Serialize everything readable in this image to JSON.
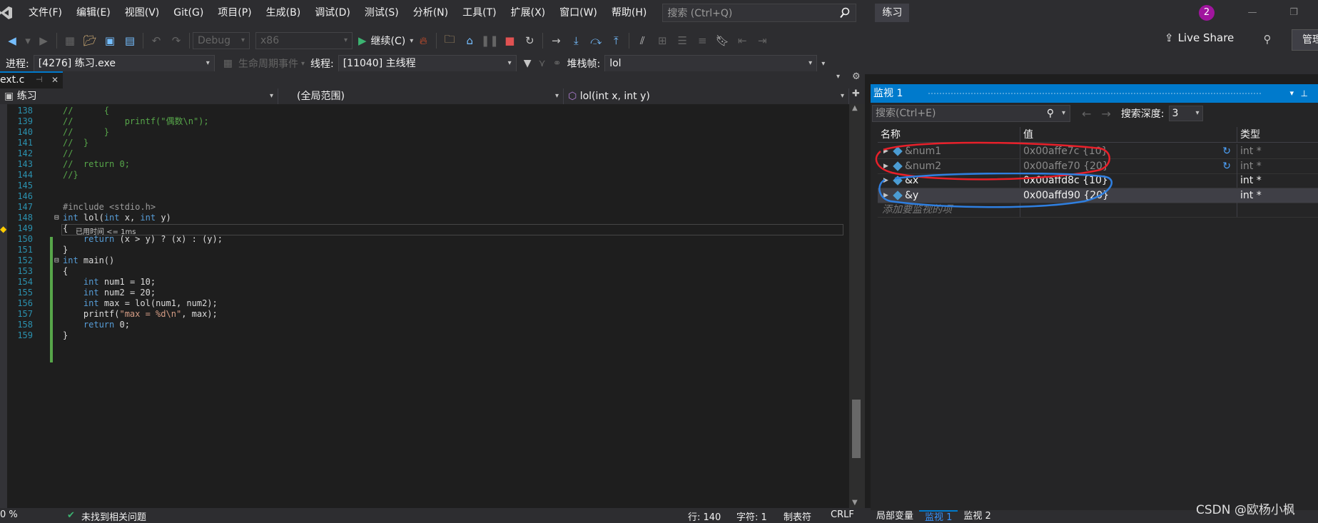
{
  "menu": {
    "items": [
      "文件(F)",
      "编辑(E)",
      "视图(V)",
      "Git(G)",
      "项目(P)",
      "生成(B)",
      "调试(D)",
      "测试(S)",
      "分析(N)",
      "工具(T)",
      "扩展(X)",
      "窗口(W)",
      "帮助(H)"
    ],
    "search_placeholder": "搜索 (Ctrl+Q)",
    "solution_name": "练习",
    "notification_count": "2"
  },
  "toolbar": {
    "configuration": "Debug",
    "platform": "x86",
    "continue_label": "继续(C)",
    "live_share_label": "Live Share",
    "manage_label": "管理"
  },
  "debug_location": {
    "process_label": "进程:",
    "process_value": "[4276] 练习.exe",
    "lifecycle_label": "生命周期事件",
    "thread_label": "线程:",
    "thread_value": "[11040] 主线程",
    "stackframe_label": "堆栈帧:",
    "stackframe_value": "lol"
  },
  "editor": {
    "tab_title": "ext.c",
    "nav_project": "练习",
    "nav_scope": "(全局范围)",
    "nav_member": "lol(int x, int y)",
    "perf_tip": "已用时间 <= 1ms",
    "lines": [
      {
        "n": "138",
        "text": "//      {"
      },
      {
        "n": "139",
        "text": "//          printf(\"偶数\\n\");"
      },
      {
        "n": "140",
        "text": "//      }"
      },
      {
        "n": "141",
        "text": "//  }"
      },
      {
        "n": "142",
        "text": "//"
      },
      {
        "n": "143",
        "text": "//  return 0;"
      },
      {
        "n": "144",
        "text": "//}"
      },
      {
        "n": "145",
        "text": ""
      },
      {
        "n": "146",
        "text": ""
      },
      {
        "n": "147",
        "text": "#include <stdio.h>"
      },
      {
        "n": "148",
        "text": "int lol(int x, int y)"
      },
      {
        "n": "149",
        "text": "{"
      },
      {
        "n": "150",
        "text": "    return (x > y) ? (x) : (y);"
      },
      {
        "n": "151",
        "text": "}"
      },
      {
        "n": "152",
        "text": "int main()"
      },
      {
        "n": "153",
        "text": "{"
      },
      {
        "n": "154",
        "text": "    int num1 = 10;"
      },
      {
        "n": "155",
        "text": "    int num2 = 20;"
      },
      {
        "n": "156",
        "text": "    int max = lol(num1, num2);"
      },
      {
        "n": "157",
        "text": "    printf(\"max = %d\\n\", max);"
      },
      {
        "n": "158",
        "text": "    return 0;"
      },
      {
        "n": "159",
        "text": "}"
      }
    ]
  },
  "watch": {
    "title": "监视 1",
    "search_placeholder": "搜索(Ctrl+E)",
    "depth_label": "搜索深度:",
    "depth_value": "3",
    "columns": [
      "名称",
      "值",
      "类型"
    ],
    "rows": [
      {
        "name": "&num1",
        "value": "0x00affe7c {10}",
        "type": "int *",
        "stale": true
      },
      {
        "name": "&num2",
        "value": "0x00affe70 {20}",
        "type": "int *",
        "stale": true
      },
      {
        "name": "&x",
        "value": "0x00affd8c {10}",
        "type": "int *",
        "stale": false
      },
      {
        "name": "&y",
        "value": "0x00affd90 {20}",
        "type": "int *",
        "stale": false
      }
    ],
    "add_item_placeholder": "添加要监视的项",
    "bottom_tabs": [
      "局部变量",
      "监视 1",
      "监视 2"
    ]
  },
  "status": {
    "zoom": "0 %",
    "issues": "未找到相关问题",
    "line": "行: 140",
    "char": "字符: 1",
    "tabs": "制表符",
    "eol": "CRLF"
  },
  "watermark": "CSDN @欧杨小枫",
  "colors": {
    "accent": "#007acc",
    "annotation_red": "#e8202a",
    "annotation_blue": "#2f7fe0"
  }
}
